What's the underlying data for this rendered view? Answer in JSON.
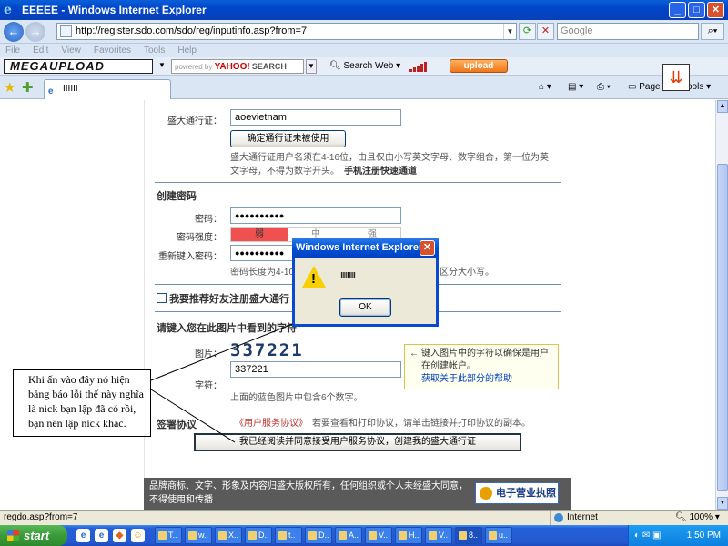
{
  "window": {
    "title": "Windows Internet Explorer",
    "title_prefix": "EEEEE"
  },
  "address": {
    "url": "http://register.sdo.com/sdo/reg/inputinfo.asp?from=7",
    "search_placeholder": "Google"
  },
  "menu": [
    "File",
    "Edit",
    "View",
    "Favorites",
    "Tools",
    "Help"
  ],
  "toolbar": {
    "brand": "MEGAUPLOAD",
    "powered_by": "powered by",
    "yahoo": "YAHOO!",
    "yahoo_search": "SEARCH",
    "search_web": "Search Web",
    "upload": "upload"
  },
  "tab": {
    "title": "IIIIII"
  },
  "commands": {
    "page": "Page",
    "tools": "Tools"
  },
  "form": {
    "account_label": "盛大通行证：",
    "account_value": "aoevietnam",
    "check_button": "确定通行证未被使用",
    "account_hint": "盛大通行证用户名须在4-16位，由且仅由小写英文字母、数字组合，第一位为英文字母，不得为数字开头。",
    "mobile_link": "手机注册快速通道",
    "password_section": "创建密码",
    "password_label": "密码：",
    "password_value": "●●●●●●●●●●",
    "strength_label": "密码强度：",
    "strength_levels": [
      "弱",
      "中",
      "强"
    ],
    "confirm_label": "重新键入密码：",
    "confirm_value": "●●●●●●●●●●",
    "password_hint_start": "密码长度为4-10",
    "password_hint_end": "区分大小写。",
    "recommend_label": "我要推荐好友注册盛大通行",
    "captcha_section": "请键入您在此图片中看到的字符",
    "image_label": "图片：",
    "captcha_image_text": "337221",
    "chars_label": "字符：",
    "captcha_value": "337221",
    "captcha_hint": "上面的蓝色图片中包含6个数字。",
    "tip_text": "键入图片中的字符以确保是用户在创建帐户。",
    "tip_link": "获取关于此部分的帮助",
    "agreement_section": "签署协议",
    "agreement_link": "《用户服务协议》",
    "agreement_text": "若要查看和打印协议，请单击链接并打印协议的副本。",
    "agree_button": "我已经阅读并同意接受用户服务协议，创建我的盛大通行证",
    "footer_text": "品牌商标、文字、形象及内容归盛大版权所有，任何组织或个人未经盛大同意，不得使用和传播",
    "footer_badge": "电子营业执照"
  },
  "dialog": {
    "title": "Windows Internet Explorer",
    "message": "IIIIIIIII",
    "ok": "OK"
  },
  "annotation": "Khi ấn vào đây nó hiện bảng báo lỗi thế này nghĩa là nick bạn lập đã có rồi, bạn nên lập nick khác.",
  "status": {
    "text": "regdo.asp?from=7",
    "zone": "Internet",
    "zoom": "100%"
  },
  "taskbar": {
    "start": "start",
    "tasks": [
      "T..",
      "w..",
      "X..",
      "D..",
      "t..",
      "D..",
      "A..",
      "V..",
      "H..",
      "V..",
      "8..",
      "u.."
    ],
    "clock": "1:50 PM"
  }
}
